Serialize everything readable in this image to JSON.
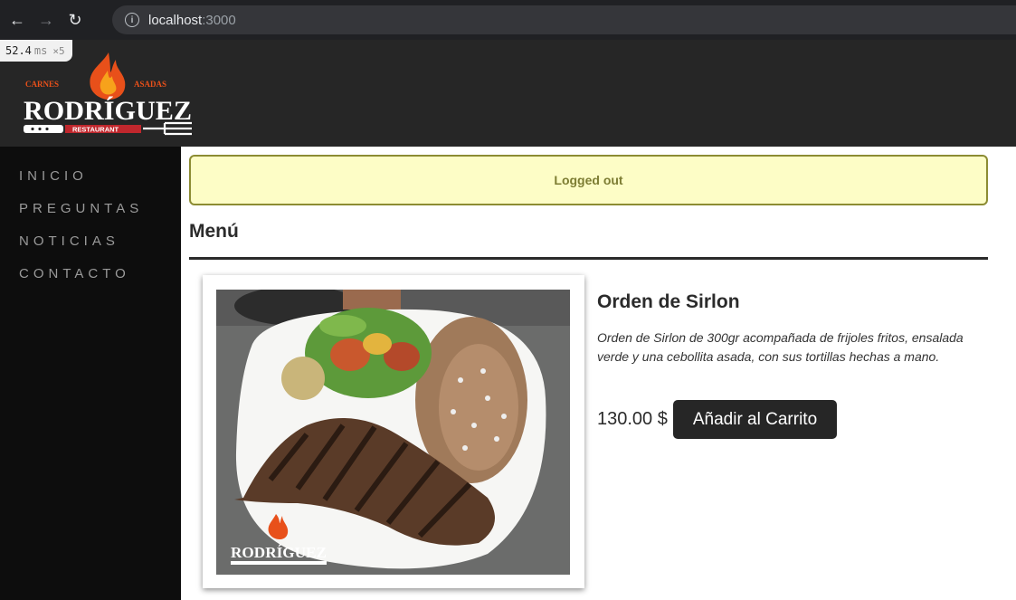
{
  "browser": {
    "url_host": "localhost",
    "url_port": ":3000",
    "perf_value": "52.4",
    "perf_unit": "ms",
    "perf_multiplier": "×5"
  },
  "header": {
    "logo_top_text_left": "CARNES",
    "logo_top_text_right": "ASADAS",
    "logo_name": "RODRÍGUEZ",
    "logo_sub": "RESTAURANT"
  },
  "sidebar": {
    "items": [
      {
        "label": "INICIO"
      },
      {
        "label": "PREGUNTAS"
      },
      {
        "label": "NOTICIAS"
      },
      {
        "label": "CONTACTO"
      }
    ]
  },
  "alert": {
    "text": "Logged out"
  },
  "menu": {
    "title": "Menú",
    "item": {
      "name": "Orden de Sirlon",
      "description": "Orden de Sirlon de 300gr acompañada de frijoles fritos, ensalada verde y una cebollita asada, con sus tortillas hechas a mano.",
      "price": "130.00 $",
      "add_button": "Añadir al Carrito"
    }
  },
  "colors": {
    "header_bg": "#262626",
    "sidebar_bg": "#0d0d0d",
    "alert_bg": "#fdfdc6",
    "alert_border": "#8c8c33",
    "flame": "#e8501a"
  }
}
